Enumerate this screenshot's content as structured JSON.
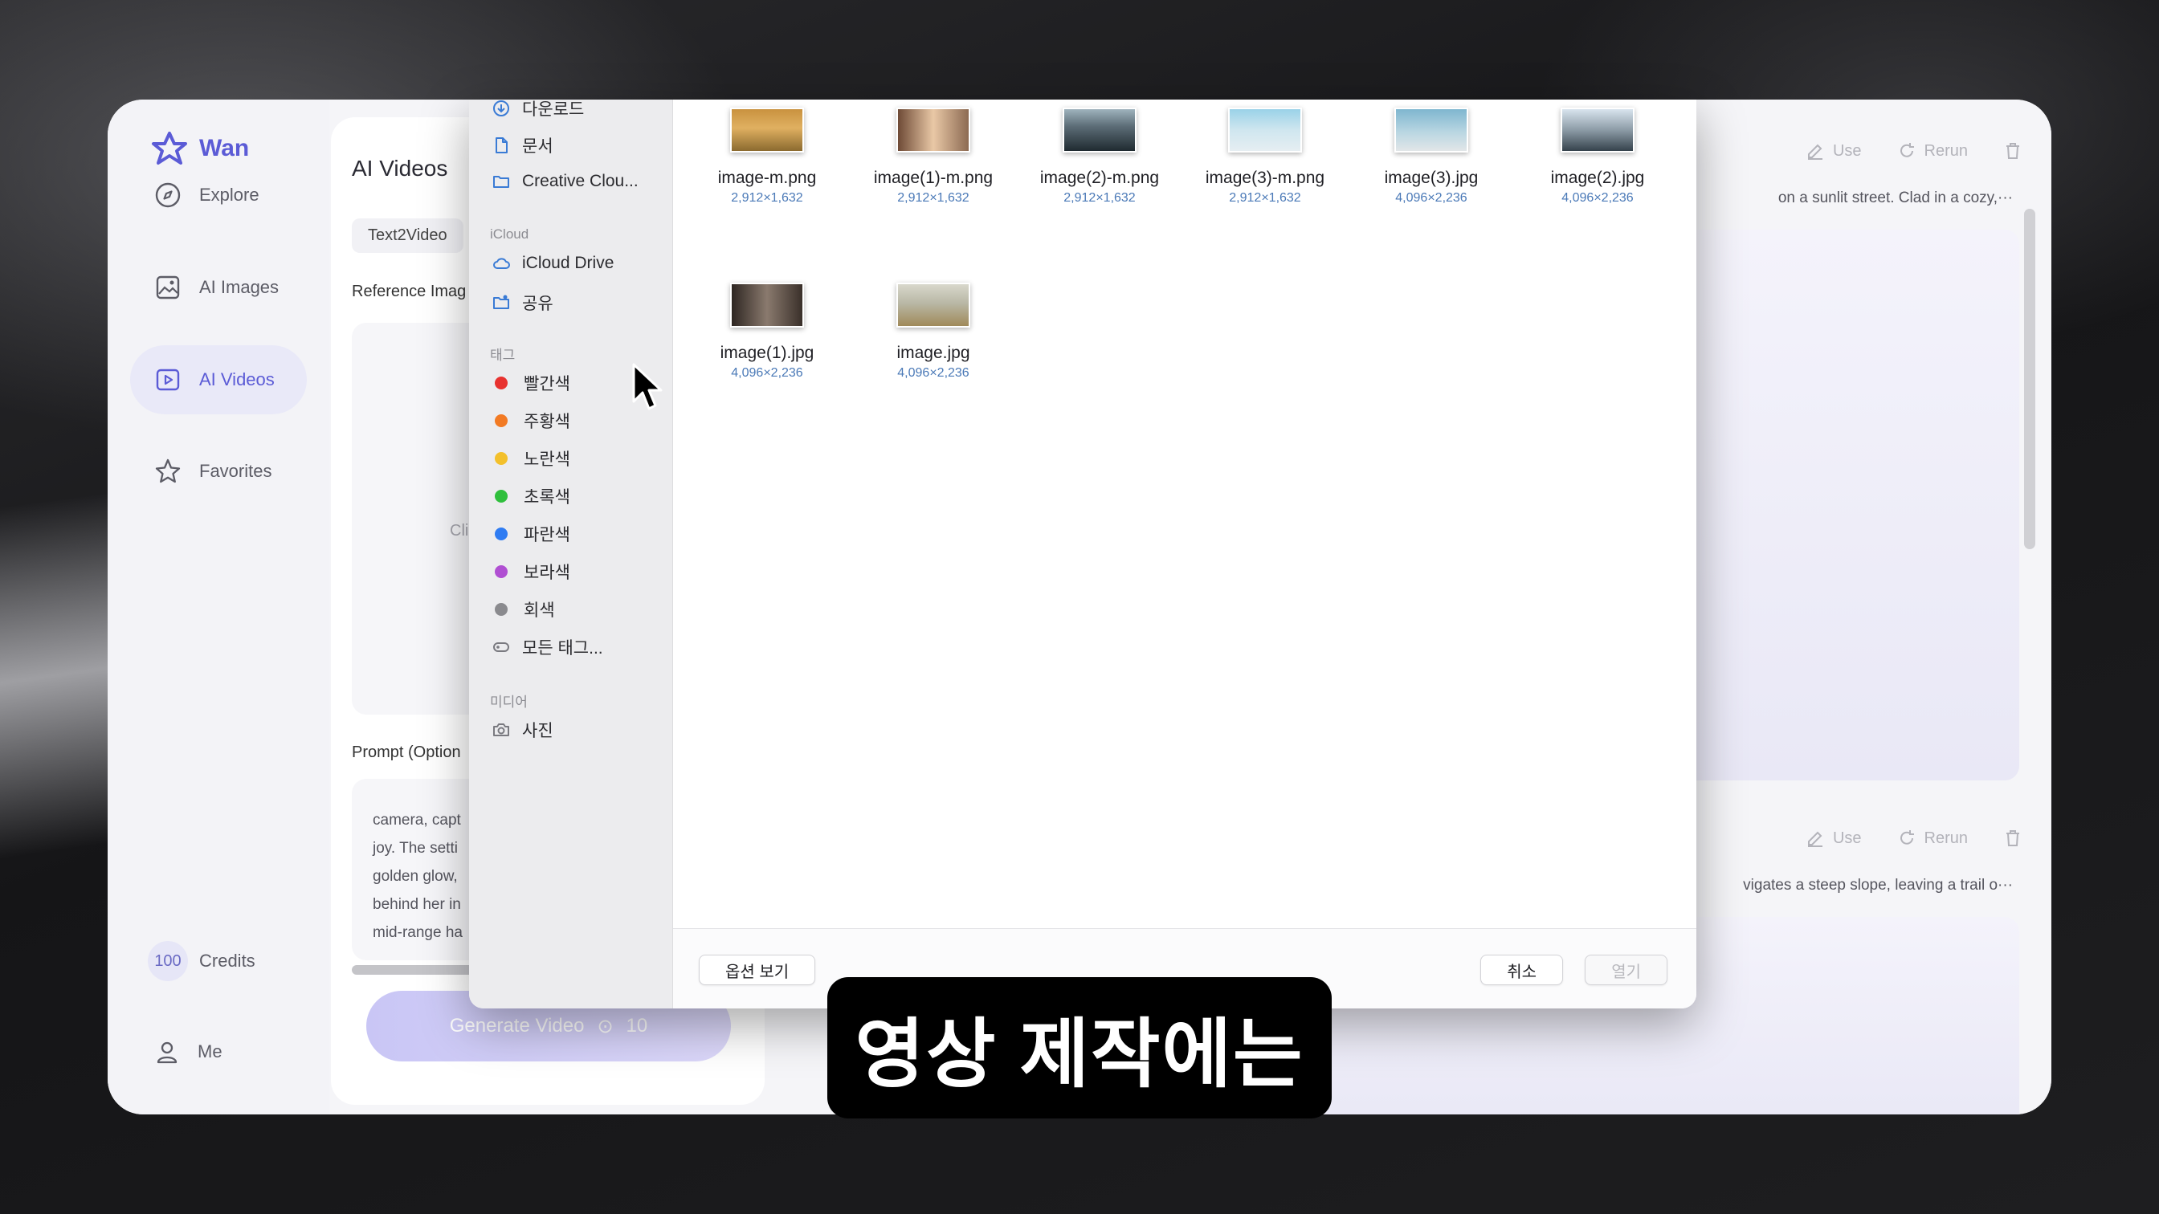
{
  "app": {
    "brand": "Wan",
    "nav": [
      {
        "label": "Explore",
        "icon": "compass-icon"
      },
      {
        "label": "AI Images",
        "icon": "image-icon"
      },
      {
        "label": "AI Videos",
        "icon": "video-icon",
        "active": true
      },
      {
        "label": "Favorites",
        "icon": "star-icon"
      }
    ],
    "credits": {
      "value": "100",
      "label": "Credits"
    },
    "me": "Me",
    "accent_color": "#5b5bd6"
  },
  "panel": {
    "title": "AI Videos",
    "tab": "Text2Video",
    "reference_label": "Reference Imag",
    "upload_hint": "Click",
    "prompt_label": "Prompt (Option",
    "prompt_lines": [
      "camera, capt",
      "joy. The setti",
      "golden glow,",
      "behind her in",
      "mid-range ha"
    ],
    "generate_label": "Generate Video",
    "generate_cost": "10"
  },
  "results": [
    {
      "use": "Use",
      "rerun": "Rerun",
      "text": "on a sunlit street. Clad in a cozy,···"
    },
    {
      "use": "Use",
      "rerun": "Rerun",
      "text": "vigates a steep slope, leaving a trail o···"
    }
  ],
  "dialog": {
    "sidebar": {
      "favorites": [
        {
          "label": "다운로드",
          "icon": "download-icon"
        },
        {
          "label": "문서",
          "icon": "document-icon"
        },
        {
          "label": "Creative Clou...",
          "icon": "folder-icon"
        }
      ],
      "icloud_header": "iCloud",
      "icloud": [
        {
          "label": "iCloud Drive",
          "icon": "cloud-icon"
        },
        {
          "label": "공유",
          "icon": "shared-folder-icon"
        }
      ],
      "tags_header": "태그",
      "tags": [
        {
          "label": "빨간색",
          "color": "#e8322f"
        },
        {
          "label": "주황색",
          "color": "#f27a23"
        },
        {
          "label": "노란색",
          "color": "#f3c02b"
        },
        {
          "label": "초록색",
          "color": "#2fbf3c"
        },
        {
          "label": "파란색",
          "color": "#2f7cf2"
        },
        {
          "label": "보라색",
          "color": "#b04fd2"
        },
        {
          "label": "회색",
          "color": "#8a8a8e"
        }
      ],
      "all_tags": "모든 태그...",
      "media_header": "미디어",
      "media": [
        {
          "label": "사진",
          "icon": "camera-icon"
        }
      ]
    },
    "files": [
      {
        "name": "image-m.png",
        "dims": "2,912×1,632",
        "thumb": [
          "#c9923f",
          "#8b6a2f"
        ]
      },
      {
        "name": "image(1)-m.png",
        "dims": "2,912×1,632",
        "thumb": [
          "#e9c8a6",
          "#6e4a36"
        ]
      },
      {
        "name": "image(2)-m.png",
        "dims": "2,912×1,632",
        "thumb": [
          "#5d6e78",
          "#1f2a30"
        ]
      },
      {
        "name": "image(3)-m.png",
        "dims": "2,912×1,632",
        "thumb": [
          "#9ad2e8",
          "#e6eef2"
        ]
      },
      {
        "name": "image(3).jpg",
        "dims": "4,096×2,236",
        "thumb": [
          "#7fb6cf",
          "#e2e6e8"
        ]
      },
      {
        "name": "image(2).jpg",
        "dims": "4,096×2,236",
        "thumb": [
          "#d8e4ee",
          "#35424c"
        ]
      },
      {
        "name": "image(1).jpg",
        "dims": "4,096×2,236",
        "thumb": [
          "#8a7a6e",
          "#2e2622"
        ]
      },
      {
        "name": "image.jpg",
        "dims": "4,096×2,236",
        "thumb": [
          "#b9b8a6",
          "#a08a5a"
        ]
      }
    ],
    "options_button": "옵션 보기",
    "cancel_button": "취소",
    "open_button": "열기"
  },
  "caption": "영상 제작에는"
}
